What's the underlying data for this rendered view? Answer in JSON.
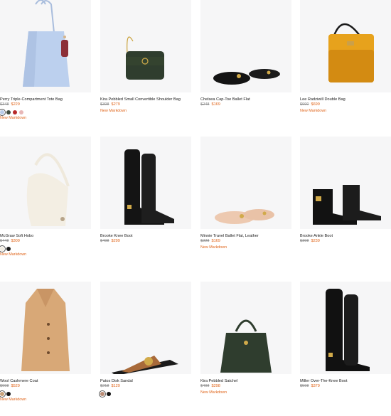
{
  "products": [
    {
      "name": "Perry Triple-Compartment Tote Bag",
      "old_price": "$348",
      "new_price": "$229",
      "swatches": [
        "#b9cbe8",
        "#3d4a3d",
        "#b82a2a",
        "#e8b7b7"
      ],
      "tag": "New Markdown"
    },
    {
      "name": "Kira Pebbled Small Convertible Shoulder Bag",
      "old_price": "$398",
      "new_price": "$279",
      "tag": "New Markdown"
    },
    {
      "name": "Chelsea Cap-Toe Ballet Flat",
      "old_price": "$248",
      "new_price": "$169"
    },
    {
      "name": "Lee Radziwill Double Bag",
      "old_price": "$990",
      "new_price": "$699",
      "tag": "New Markdown"
    },
    {
      "name": "McGraw Soft Hobo",
      "old_price": "$448",
      "new_price": "$309",
      "swatches": [
        "#f2ede2",
        "#1a1a1a"
      ],
      "tag": "New Markdown"
    },
    {
      "name": "Brooke Knee Boot",
      "old_price": "$498",
      "new_price": "$299"
    },
    {
      "name": "Minnie Travel Ballet Flat, Leather",
      "old_price": "$228",
      "new_price": "$169",
      "tag": "New Markdown"
    },
    {
      "name": "Brooke Ankle Boot",
      "old_price": "$398",
      "new_price": "$239"
    },
    {
      "name": "Wool Cashmere Coat",
      "old_price": "$998",
      "new_price": "$529",
      "swatches": [
        "#c9a27a",
        "#111111"
      ],
      "tag": "New Markdown"
    },
    {
      "name": "Patos Disk Sandal",
      "old_price": "$218",
      "new_price": "$129",
      "swatches": [
        "#b98b74",
        "#111111"
      ]
    },
    {
      "name": "Kira Pebbled Satchel",
      "old_price": "$498",
      "new_price": "$298",
      "tag": "New Markdown"
    },
    {
      "name": "Miller Over-The-Knee Boot",
      "old_price": "$598",
      "new_price": "$379"
    }
  ]
}
